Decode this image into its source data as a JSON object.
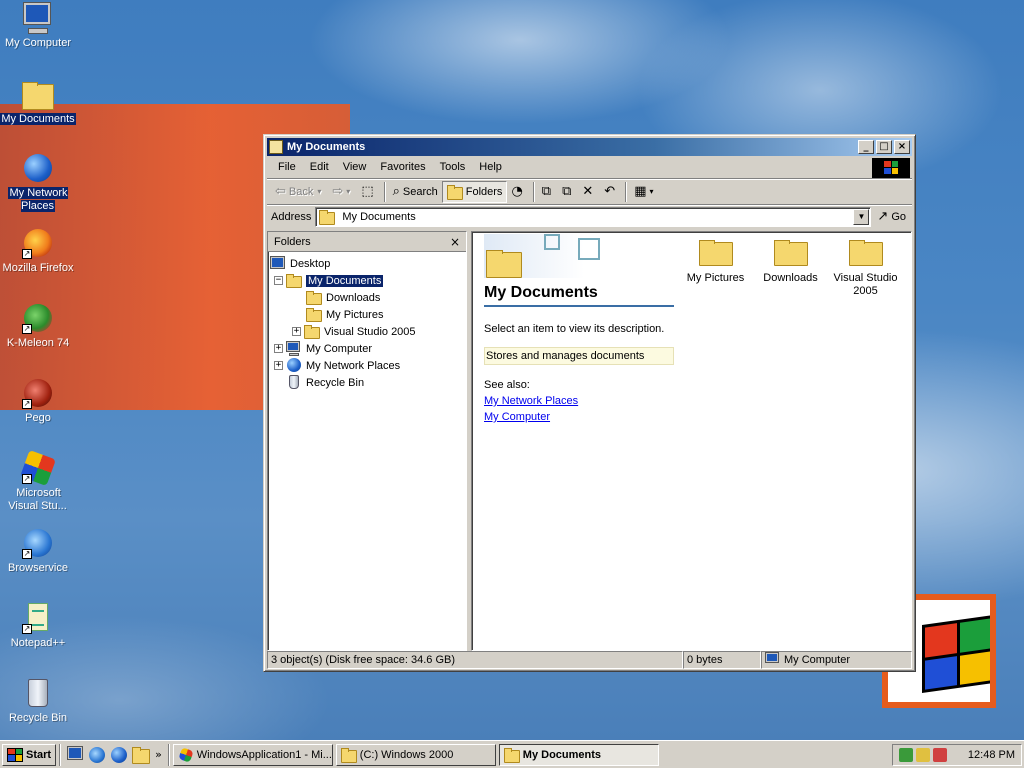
{
  "desktop": {
    "icons": [
      {
        "label": "My Computer"
      },
      {
        "label": "My Documents"
      },
      {
        "label": "My Network Places"
      },
      {
        "label": "Mozilla Firefox"
      },
      {
        "label": "K-Meleon 74"
      },
      {
        "label": "Pego"
      },
      {
        "label": "Microsoft Visual Stu..."
      },
      {
        "label": "Browservice"
      },
      {
        "label": "Notepad++"
      },
      {
        "label": "Recycle Bin"
      }
    ]
  },
  "window": {
    "title": "My Documents",
    "controls": {
      "minimize": "_",
      "maximize": "□",
      "close": "×"
    },
    "menu": [
      "File",
      "Edit",
      "View",
      "Favorites",
      "Tools",
      "Help"
    ],
    "toolbar": {
      "back": "Back",
      "search": "Search",
      "folders": "Folders"
    },
    "address": {
      "label": "Address",
      "value": "My Documents",
      "go": "Go"
    },
    "folders_pane": {
      "title": "Folders",
      "close": "×",
      "tree": [
        {
          "label": "Desktop"
        },
        {
          "label": "My Documents",
          "selected": true
        },
        {
          "label": "Downloads"
        },
        {
          "label": "My Pictures"
        },
        {
          "label": "Visual Studio 2005"
        },
        {
          "label": "My Computer"
        },
        {
          "label": "My Network Places"
        },
        {
          "label": "Recycle Bin"
        }
      ]
    },
    "webview": {
      "title": "My Documents",
      "prompt": "Select an item to view its description.",
      "description": "Stores and manages documents",
      "see_also": "See also:",
      "links": [
        "My Network Places",
        "My Computer"
      ]
    },
    "files": [
      {
        "name": "My Pictures"
      },
      {
        "name": "Downloads"
      },
      {
        "name": "Visual Studio 2005"
      }
    ],
    "status": {
      "objects": "3 object(s) (Disk free space: 34.6 GB)",
      "size": "0 bytes",
      "location": "My Computer"
    }
  },
  "taskbar": {
    "start": "Start",
    "quick_more": "»",
    "tasks": [
      {
        "label": "WindowsApplication1 - Mi..."
      },
      {
        "label": "(C:) Windows 2000"
      },
      {
        "label": "My Documents"
      }
    ],
    "clock": "12:48 PM"
  },
  "colors": {
    "titlebar_start": "#0a246a",
    "titlebar_end": "#a6caf0",
    "selection": "#0a246a",
    "window_face": "#d4d0c8",
    "desktop": "#3a6ea5",
    "wallpaper_orange": "#e55c1d"
  }
}
